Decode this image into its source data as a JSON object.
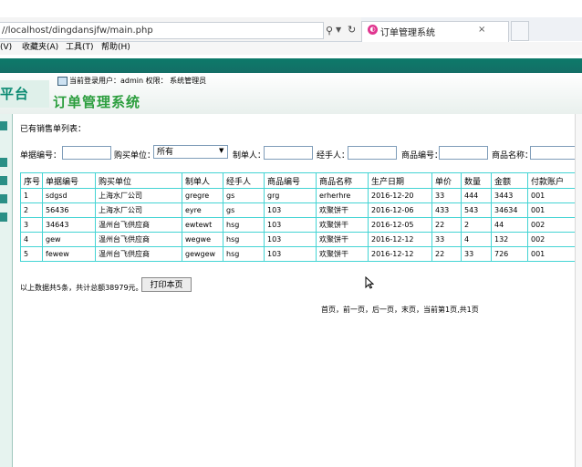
{
  "browser": {
    "url": "//localhost/dingdansjfw/main.php",
    "tab_title": "订单管理系统",
    "tab_close": "×",
    "menu": [
      "(V)",
      "收藏夹(A)",
      "工具(T)",
      "帮助(H)"
    ]
  },
  "header": {
    "logo_text": "平台",
    "user_info": "当前登录用户：admin  权限：  系统管理员",
    "title": "订单管理系统"
  },
  "main": {
    "caption": "已有销售单列表：",
    "filters": {
      "order_no_label": "单据编号：",
      "buyer_label": "购买单位：",
      "buyer_selected": "所有",
      "maker_label": "制单人：",
      "handler_label": "经手人：",
      "product_no_label": "商品编号：",
      "product_name_label": "商品名称："
    },
    "table": {
      "headers": [
        "序号",
        "单据编号",
        "购买单位",
        "制单人",
        "经手人",
        "商品编号",
        "商品名称",
        "生产日期",
        "单价",
        "数量",
        "金额",
        "付款账户"
      ],
      "rows": [
        [
          "1",
          "sdgsd",
          "上海水厂公司",
          "gregre",
          "gs",
          "grg",
          "erherhre",
          "2016-12-20",
          "33",
          "444",
          "3443",
          "001"
        ],
        [
          "2",
          "56436",
          "上海水厂公司",
          "eyre",
          "gs",
          "103",
          "欢聚饼干",
          "2016-12-06",
          "433",
          "543",
          "34634",
          "001"
        ],
        [
          "3",
          "34643",
          "温州台飞供应商",
          "ewtewt",
          "hsg",
          "103",
          "欢聚饼干",
          "2016-12-05",
          "22",
          "2",
          "44",
          "002"
        ],
        [
          "4",
          "gew",
          "温州台飞供应商",
          "wegwe",
          "hsg",
          "103",
          "欢聚饼干",
          "2016-12-12",
          "33",
          "4",
          "132",
          "002"
        ],
        [
          "5",
          "fewew",
          "温州台飞供应商",
          "gewgew",
          "hsg",
          "103",
          "欢聚饼干",
          "2016-12-12",
          "22",
          "33",
          "726",
          "001"
        ]
      ]
    },
    "summary": "以上数据共5条，共计总额38979元。",
    "print_button": "打印本页",
    "pager": "首页，前一页，后一页，末页，当前第1页,共1页"
  },
  "icons": {
    "search": "⚲",
    "dropdown": "▼",
    "refresh": "↻",
    "tab_icon": "◐",
    "select_arrow": "▼"
  },
  "colors": {
    "header_band": "#0d7a6a",
    "title_green": "#2c9e3e",
    "table_border": "#44d4d4"
  }
}
